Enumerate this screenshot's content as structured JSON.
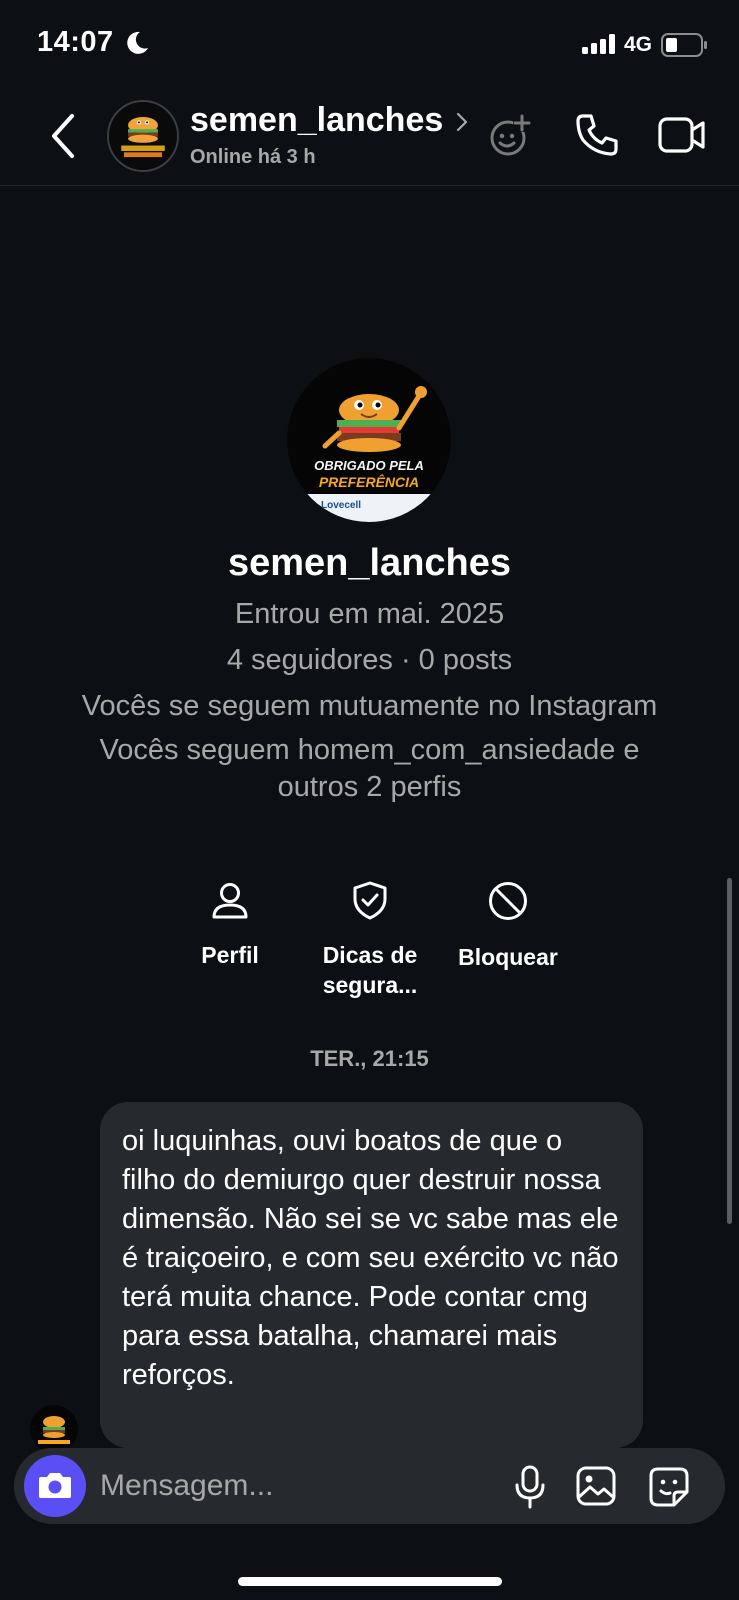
{
  "status_bar": {
    "time": "14:07",
    "network": "4G",
    "icons": [
      "moon-icon",
      "signal-icon",
      "battery-icon"
    ]
  },
  "header": {
    "username": "semen_lanches",
    "status": "Online há 3 h",
    "icons": [
      "back-icon",
      "effects-icon",
      "phone-icon",
      "video-icon"
    ]
  },
  "profile": {
    "name": "semen_lanches",
    "avatar_text_top": "OBRIGADO PELA",
    "avatar_text_bottom": "PREFERÊNCIA",
    "avatar_footer": "Lovecell",
    "joined": "Entrou em mai. 2025",
    "stats": "4 seguidores · 0 posts",
    "mutual": "Vocês se seguem mutuamente no Instagram",
    "follows_line1": "Vocês seguem homem_com_ansiedade e",
    "follows_line2": "outros 2 perfis"
  },
  "actions": {
    "profile_label": "Perfil",
    "safety_label_line1": "Dicas de",
    "safety_label_line2": "segura...",
    "block_label": "Bloquear"
  },
  "thread": {
    "timestamp": "TER., 21:15",
    "message": "oi luquinhas, ouvi boatos de que o filho do demiurgo quer destruir nossa dimensão. Não sei se vc sabe mas ele é traiçoeiro, e com seu exército vc não terá muita chance. Pode contar cmg para essa batalha, chamarei mais reforços."
  },
  "composer": {
    "placeholder": "Mensagem..."
  },
  "colors": {
    "background": "#0c1014",
    "bubble": "#262a2f",
    "secondary_text": "#a8a8a8",
    "camera_button": "#5a4ff5"
  }
}
